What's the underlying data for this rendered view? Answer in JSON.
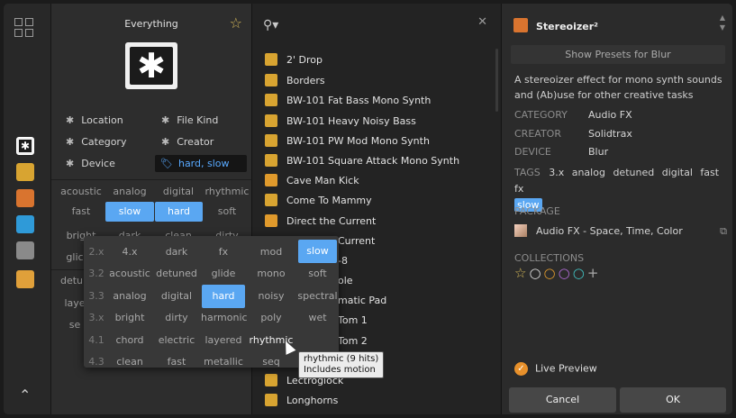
{
  "filters": {
    "title": "Everything",
    "location": "Location",
    "file_kind": "File Kind",
    "category": "Category",
    "creator": "Creator",
    "device": "Device",
    "tags_selected": "hard, slow"
  },
  "tag_grid": [
    [
      "acoustic",
      "analog",
      "digital",
      "rhythmic"
    ],
    [
      "fast",
      "slow",
      "hard",
      "soft"
    ],
    [
      "bright",
      "dark",
      "clean",
      "dirty"
    ],
    [
      "glic",
      "",
      "",
      ""
    ],
    [
      "detun",
      "",
      "",
      ""
    ],
    [
      "laye",
      "",
      "",
      ""
    ],
    [
      "se",
      "",
      "",
      ""
    ]
  ],
  "results": [
    "2' Drop",
    "Borders",
    "BW-101 Fat Bass Mono Synth",
    "BW-101 Heavy Noisy Bass",
    "BW-101 PW Mod Mono Synth",
    "BW-101 Square Attack Mono Synth",
    "Cave Man Kick",
    "Come To Mammy",
    "Direct the Current",
    "Current",
    "-8",
    "ole",
    "matic Pad",
    "Tom 1",
    "Tom 2",
    "Lectroglock",
    "Longhorns"
  ],
  "popup": {
    "rows": [
      {
        "ver": "2.x",
        "tags": [
          "4.x",
          "dark",
          "fx",
          "mod",
          "slow"
        ]
      },
      {
        "ver": "3.2",
        "tags": [
          "acoustic",
          "detuned",
          "glide",
          "mono",
          "soft"
        ]
      },
      {
        "ver": "3.3",
        "tags": [
          "analog",
          "digital",
          "hard",
          "noisy",
          "spectral"
        ]
      },
      {
        "ver": "3.x",
        "tags": [
          "bright",
          "dirty",
          "harmonic",
          "poly",
          "wet"
        ]
      },
      {
        "ver": "4.1",
        "tags": [
          "chord",
          "electric",
          "layered",
          "rhythmic",
          ""
        ]
      },
      {
        "ver": "4.3",
        "tags": [
          "clean",
          "fast",
          "metallic",
          "seq",
          ""
        ]
      }
    ],
    "tooltip_line1": "rhythmic (9 hits)",
    "tooltip_line2": "Includes motion"
  },
  "inspector": {
    "device_name": "Stereoizer²",
    "show_presets": "Show Presets for Blur",
    "description": "A stereoizer effect for mono synth sounds and (Ab)use for other creative tasks",
    "category_label": "CATEGORY",
    "category_value": "Audio FX",
    "creator_label": "CREATOR",
    "creator_value": "Solidtrax",
    "device_label": "DEVICE",
    "device_value": "Blur",
    "tags_label": "TAGS",
    "tags": [
      "3.x",
      "analog",
      "detuned",
      "digital",
      "fast",
      "fx"
    ],
    "tag_selected": "slow",
    "package_label": "PACKAGE",
    "package_value": "Audio FX - Space, Time, Color",
    "collections_label": "COLLECTIONS",
    "live_preview": "Live Preview",
    "cancel": "Cancel",
    "ok": "OK"
  },
  "colors": {
    "accent": "#5aa7f2",
    "orange": "#e7902b"
  }
}
